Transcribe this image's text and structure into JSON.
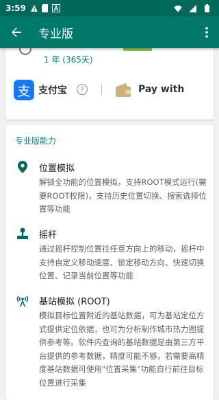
{
  "status_bar": {
    "time": "3:59",
    "icons": [
      "warning-icon",
      "sd-card-icon",
      "a-box-icon",
      "wifi-icon",
      "signal-icon",
      "battery-icon"
    ]
  },
  "app_bar": {
    "title": "专业版",
    "back_icon": "arrow-back-icon",
    "more_icon": "more-vert-icon"
  },
  "plan": {
    "duration": "1 年 (365天)"
  },
  "payment": {
    "alipay_label": "支付宝",
    "alipay_logo_glyph": "支",
    "help_glyph": "?",
    "applepay_label": "Pay with"
  },
  "features": {
    "section_title": "专业版能力",
    "items": [
      {
        "icon": "location-pin-icon",
        "title": "位置模拟",
        "desc": "解锁全功能的位置模拟，支持ROOT模式运行(需要ROOT权限)，支持历史位置切换、搜索选择位置等功能"
      },
      {
        "icon": "joystick-icon",
        "title": "摇杆",
        "desc": "通过摇杆控制位置往任意方向上的移动，摇杆中支持自定义移动速度、锁定移动方向、快速切换位置、记录当前位置等功能"
      },
      {
        "icon": "cell-tower-icon",
        "title": "基站模拟 (ROOT)",
        "desc": "模拟目标位置附近的基站数据，可为基站定位方式提供定位依据，也可为分析制作城市热力图提供参考等。软件内查询的基站数据是由第三方平台提供的参考数据，精度可能不够，若需要高精度基站数据可使用\"位置采集\"功能自行前往目标位置进行采集"
      }
    ]
  },
  "colors": {
    "status_bar": "#00695c",
    "app_bar": "#00796b",
    "accent": "#00897b",
    "alipay_blue": "#1677ff"
  }
}
